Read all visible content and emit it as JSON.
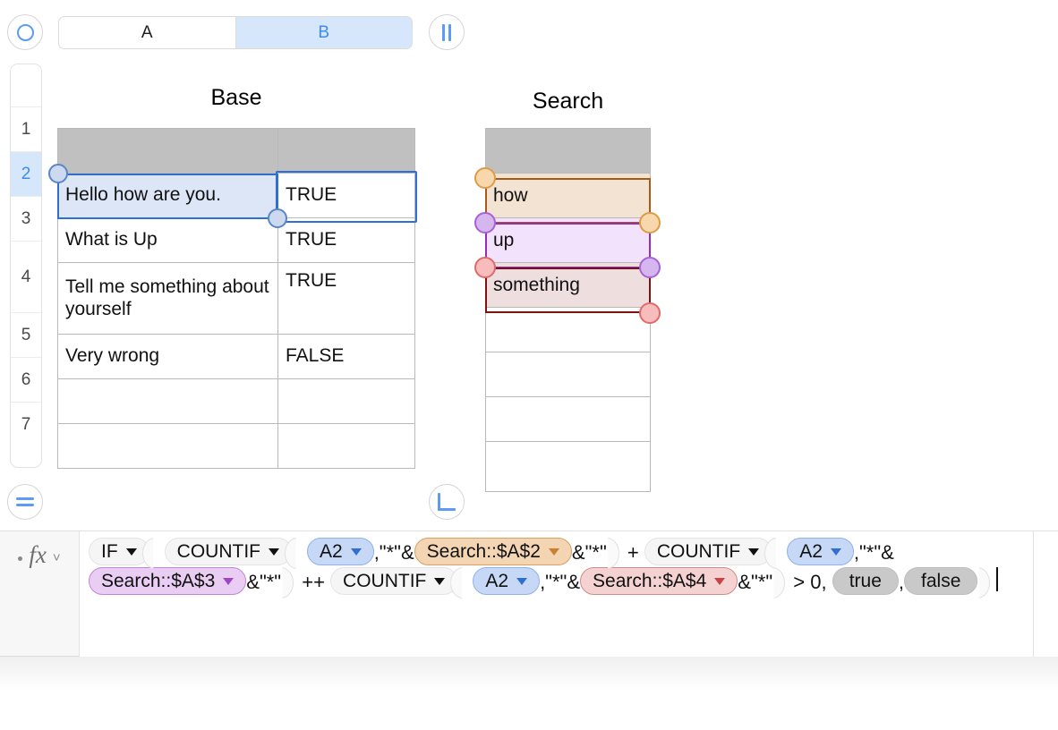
{
  "toolbar": {
    "prev_icon": "circle-icon",
    "pause_icon": "pause-icon",
    "segments": [
      {
        "label": "A",
        "active": false
      },
      {
        "label": "B",
        "active": true
      }
    ]
  },
  "row_rail": {
    "rows": [
      "",
      "1",
      "2",
      "3",
      "4",
      "5",
      "6",
      "7"
    ],
    "selected_row": "2"
  },
  "base_sheet": {
    "title": "Base",
    "rows": [
      {
        "a": "",
        "b": "",
        "header": true
      },
      {
        "a": "Hello how are you.",
        "b": "TRUE"
      },
      {
        "a": "What is Up",
        "b": "TRUE"
      },
      {
        "a": "Tell me something about yourself",
        "b": "TRUE"
      },
      {
        "a": "Very wrong",
        "b": "FALSE"
      },
      {
        "a": "",
        "b": ""
      },
      {
        "a": "",
        "b": ""
      }
    ],
    "selected_cell": "A2",
    "active_cell": "B2"
  },
  "search_sheet": {
    "title": "Search",
    "rows": [
      {
        "a": "",
        "header": true
      },
      {
        "a": "how",
        "highlight": "orange"
      },
      {
        "a": "up",
        "highlight": "purple"
      },
      {
        "a": "something",
        "highlight": "red"
      },
      {
        "a": ""
      },
      {
        "a": ""
      },
      {
        "a": ""
      },
      {
        "a": ""
      }
    ]
  },
  "corner_buttons": {
    "equals_icon": "equals-icon",
    "corner_icon": "corner-bracket-icon"
  },
  "formula_bar": {
    "fx_label": "fx",
    "chevron": "˅",
    "tokens": [
      {
        "type": "pill-fn",
        "text": "IF"
      },
      {
        "type": "paren-open"
      },
      {
        "type": "pill-fn",
        "text": "COUNTIF"
      },
      {
        "type": "paren-open"
      },
      {
        "type": "pill-ref-blue",
        "text": "A2"
      },
      {
        "type": "text",
        "text": ",\"*\"&"
      },
      {
        "type": "pill-ref-orange",
        "text": "Search::$A$2"
      },
      {
        "type": "text",
        "text": "&\"*\""
      },
      {
        "type": "paren-close"
      },
      {
        "type": "text",
        "text": " + "
      },
      {
        "type": "pill-fn",
        "text": "COUNTIF"
      },
      {
        "type": "paren-open"
      },
      {
        "type": "pill-ref-blue",
        "text": "A2"
      },
      {
        "type": "text",
        "text": ",\"*\"&"
      },
      {
        "type": "pill-ref-purple",
        "text": "Search::$A$3"
      },
      {
        "type": "text",
        "text": "&\"*\""
      },
      {
        "type": "paren-close"
      },
      {
        "type": "text",
        "text": " ++ "
      },
      {
        "type": "pill-fn",
        "text": "COUNTIF"
      },
      {
        "type": "paren-open"
      },
      {
        "type": "pill-ref-blue",
        "text": "A2"
      },
      {
        "type": "text",
        "text": ",\"*\"&"
      },
      {
        "type": "pill-ref-red",
        "text": "Search::$A$4"
      },
      {
        "type": "text",
        "text": "&\"*\""
      },
      {
        "type": "paren-close"
      },
      {
        "type": "text",
        "text": " > 0, "
      },
      {
        "type": "pill-bool",
        "text": "true"
      },
      {
        "type": "text",
        "text": ","
      },
      {
        "type": "pill-bool",
        "text": "false"
      },
      {
        "type": "paren-close"
      },
      {
        "type": "caret"
      }
    ]
  },
  "colors": {
    "accent_blue": "#3d8bf2",
    "selection_blue": "#2f6fd0",
    "selection_fill": "#dce6f7",
    "header_gray": "#c0c0c0",
    "range_orange_border": "#a65a17",
    "range_orange_fill": "#f2e3d2",
    "range_orange_handle": "#f7d7ab",
    "range_purple_border": "#8e2fbd",
    "range_purple_fill": "#f3e2fb",
    "range_purple_handle": "#d6b6ef",
    "range_red_border": "#7d1212",
    "range_red_fill": "#efdede",
    "range_red_handle": "#f8bcbc"
  }
}
